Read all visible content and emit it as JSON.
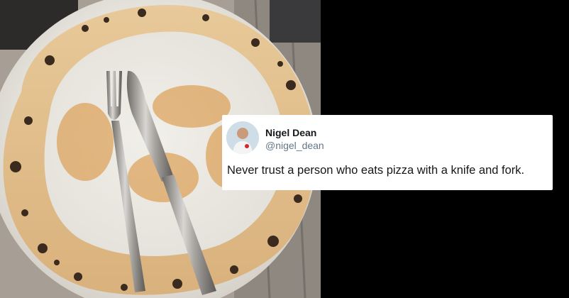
{
  "tweet": {
    "display_name": "Nigel Dean",
    "handle": "@nigel_dean",
    "text": "Never trust a person who eats pizza with a knife and fork."
  },
  "colors": {
    "card_bg": "#ffffff",
    "name": "#14171a",
    "handle": "#657786",
    "background": "#000000"
  },
  "icons": [
    "avatar"
  ]
}
